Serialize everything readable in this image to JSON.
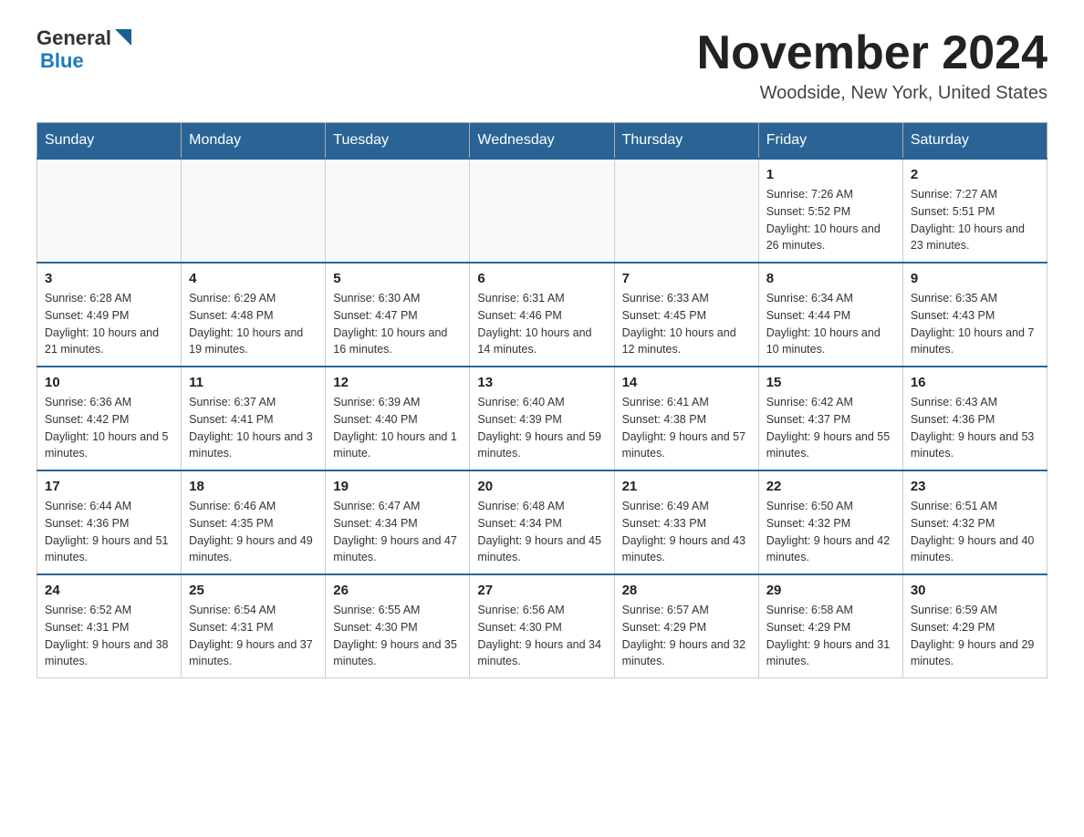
{
  "header": {
    "logo": {
      "general": "General",
      "blue": "Blue"
    },
    "title": "November 2024",
    "location": "Woodside, New York, United States"
  },
  "calendar": {
    "days_of_week": [
      "Sunday",
      "Monday",
      "Tuesday",
      "Wednesday",
      "Thursday",
      "Friday",
      "Saturday"
    ],
    "weeks": [
      {
        "days": [
          {
            "number": "",
            "empty": true
          },
          {
            "number": "",
            "empty": true
          },
          {
            "number": "",
            "empty": true
          },
          {
            "number": "",
            "empty": true
          },
          {
            "number": "",
            "empty": true
          },
          {
            "number": "1",
            "sunrise": "Sunrise: 7:26 AM",
            "sunset": "Sunset: 5:52 PM",
            "daylight": "Daylight: 10 hours and 26 minutes."
          },
          {
            "number": "2",
            "sunrise": "Sunrise: 7:27 AM",
            "sunset": "Sunset: 5:51 PM",
            "daylight": "Daylight: 10 hours and 23 minutes."
          }
        ]
      },
      {
        "days": [
          {
            "number": "3",
            "sunrise": "Sunrise: 6:28 AM",
            "sunset": "Sunset: 4:49 PM",
            "daylight": "Daylight: 10 hours and 21 minutes."
          },
          {
            "number": "4",
            "sunrise": "Sunrise: 6:29 AM",
            "sunset": "Sunset: 4:48 PM",
            "daylight": "Daylight: 10 hours and 19 minutes."
          },
          {
            "number": "5",
            "sunrise": "Sunrise: 6:30 AM",
            "sunset": "Sunset: 4:47 PM",
            "daylight": "Daylight: 10 hours and 16 minutes."
          },
          {
            "number": "6",
            "sunrise": "Sunrise: 6:31 AM",
            "sunset": "Sunset: 4:46 PM",
            "daylight": "Daylight: 10 hours and 14 minutes."
          },
          {
            "number": "7",
            "sunrise": "Sunrise: 6:33 AM",
            "sunset": "Sunset: 4:45 PM",
            "daylight": "Daylight: 10 hours and 12 minutes."
          },
          {
            "number": "8",
            "sunrise": "Sunrise: 6:34 AM",
            "sunset": "Sunset: 4:44 PM",
            "daylight": "Daylight: 10 hours and 10 minutes."
          },
          {
            "number": "9",
            "sunrise": "Sunrise: 6:35 AM",
            "sunset": "Sunset: 4:43 PM",
            "daylight": "Daylight: 10 hours and 7 minutes."
          }
        ]
      },
      {
        "days": [
          {
            "number": "10",
            "sunrise": "Sunrise: 6:36 AM",
            "sunset": "Sunset: 4:42 PM",
            "daylight": "Daylight: 10 hours and 5 minutes."
          },
          {
            "number": "11",
            "sunrise": "Sunrise: 6:37 AM",
            "sunset": "Sunset: 4:41 PM",
            "daylight": "Daylight: 10 hours and 3 minutes."
          },
          {
            "number": "12",
            "sunrise": "Sunrise: 6:39 AM",
            "sunset": "Sunset: 4:40 PM",
            "daylight": "Daylight: 10 hours and 1 minute."
          },
          {
            "number": "13",
            "sunrise": "Sunrise: 6:40 AM",
            "sunset": "Sunset: 4:39 PM",
            "daylight": "Daylight: 9 hours and 59 minutes."
          },
          {
            "number": "14",
            "sunrise": "Sunrise: 6:41 AM",
            "sunset": "Sunset: 4:38 PM",
            "daylight": "Daylight: 9 hours and 57 minutes."
          },
          {
            "number": "15",
            "sunrise": "Sunrise: 6:42 AM",
            "sunset": "Sunset: 4:37 PM",
            "daylight": "Daylight: 9 hours and 55 minutes."
          },
          {
            "number": "16",
            "sunrise": "Sunrise: 6:43 AM",
            "sunset": "Sunset: 4:36 PM",
            "daylight": "Daylight: 9 hours and 53 minutes."
          }
        ]
      },
      {
        "days": [
          {
            "number": "17",
            "sunrise": "Sunrise: 6:44 AM",
            "sunset": "Sunset: 4:36 PM",
            "daylight": "Daylight: 9 hours and 51 minutes."
          },
          {
            "number": "18",
            "sunrise": "Sunrise: 6:46 AM",
            "sunset": "Sunset: 4:35 PM",
            "daylight": "Daylight: 9 hours and 49 minutes."
          },
          {
            "number": "19",
            "sunrise": "Sunrise: 6:47 AM",
            "sunset": "Sunset: 4:34 PM",
            "daylight": "Daylight: 9 hours and 47 minutes."
          },
          {
            "number": "20",
            "sunrise": "Sunrise: 6:48 AM",
            "sunset": "Sunset: 4:34 PM",
            "daylight": "Daylight: 9 hours and 45 minutes."
          },
          {
            "number": "21",
            "sunrise": "Sunrise: 6:49 AM",
            "sunset": "Sunset: 4:33 PM",
            "daylight": "Daylight: 9 hours and 43 minutes."
          },
          {
            "number": "22",
            "sunrise": "Sunrise: 6:50 AM",
            "sunset": "Sunset: 4:32 PM",
            "daylight": "Daylight: 9 hours and 42 minutes."
          },
          {
            "number": "23",
            "sunrise": "Sunrise: 6:51 AM",
            "sunset": "Sunset: 4:32 PM",
            "daylight": "Daylight: 9 hours and 40 minutes."
          }
        ]
      },
      {
        "days": [
          {
            "number": "24",
            "sunrise": "Sunrise: 6:52 AM",
            "sunset": "Sunset: 4:31 PM",
            "daylight": "Daylight: 9 hours and 38 minutes."
          },
          {
            "number": "25",
            "sunrise": "Sunrise: 6:54 AM",
            "sunset": "Sunset: 4:31 PM",
            "daylight": "Daylight: 9 hours and 37 minutes."
          },
          {
            "number": "26",
            "sunrise": "Sunrise: 6:55 AM",
            "sunset": "Sunset: 4:30 PM",
            "daylight": "Daylight: 9 hours and 35 minutes."
          },
          {
            "number": "27",
            "sunrise": "Sunrise: 6:56 AM",
            "sunset": "Sunset: 4:30 PM",
            "daylight": "Daylight: 9 hours and 34 minutes."
          },
          {
            "number": "28",
            "sunrise": "Sunrise: 6:57 AM",
            "sunset": "Sunset: 4:29 PM",
            "daylight": "Daylight: 9 hours and 32 minutes."
          },
          {
            "number": "29",
            "sunrise": "Sunrise: 6:58 AM",
            "sunset": "Sunset: 4:29 PM",
            "daylight": "Daylight: 9 hours and 31 minutes."
          },
          {
            "number": "30",
            "sunrise": "Sunrise: 6:59 AM",
            "sunset": "Sunset: 4:29 PM",
            "daylight": "Daylight: 9 hours and 29 minutes."
          }
        ]
      }
    ]
  }
}
